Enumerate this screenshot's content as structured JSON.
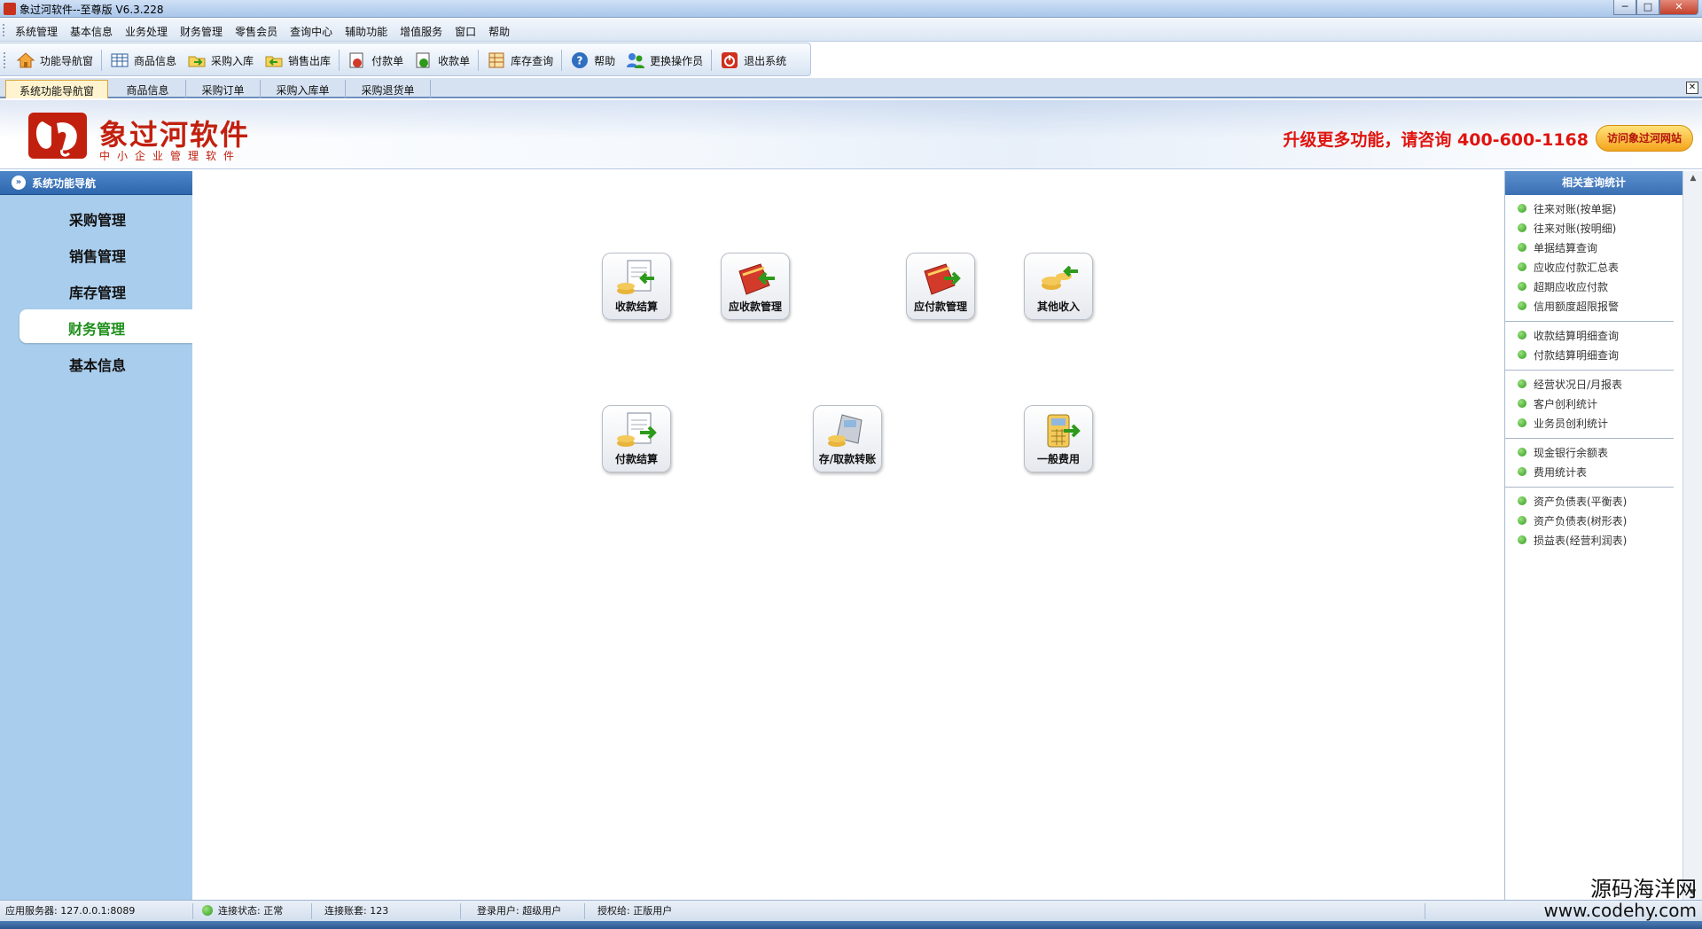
{
  "window": {
    "title": "象过河软件--至尊版 V6.3.228",
    "buttons": {
      "minimize": "─",
      "maximize": "□",
      "close": "✕"
    }
  },
  "menu": [
    "系统管理",
    "基本信息",
    "业务处理",
    "财务管理",
    "零售会员",
    "查询中心",
    "辅助功能",
    "增值服务",
    "窗口",
    "帮助"
  ],
  "toolbar": {
    "nav": "功能导航窗",
    "goods": "商品信息",
    "purchase_in": "采购入库",
    "sales_out": "销售出库",
    "payment": "付款单",
    "receipt": "收款单",
    "stock_query": "库存查询",
    "help": "帮助",
    "switch_user": "更换操作员",
    "exit": "退出系统"
  },
  "tabs": {
    "nav_window": "系统功能导航窗",
    "goods": "商品信息",
    "purchase_order": "采购订单",
    "purchase_in": "采购入库单",
    "purchase_return": "采购退货单",
    "close": "✕"
  },
  "banner": {
    "logo_title": "象过河软件",
    "logo_subtitle": "中小企业管理软件",
    "promo": "升级更多功能，请咨询 400-600-1168",
    "visit_button": "访问象过河网站"
  },
  "leftnav": {
    "header": "系统功能导航",
    "chevron": "»",
    "items": [
      "采购管理",
      "销售管理",
      "库存管理",
      "财务管理",
      "基本信息"
    ],
    "active_index": 3
  },
  "modules": {
    "receipt_settle": "收款结算",
    "receivable": "应收款管理",
    "payable": "应付款管理",
    "other_income": "其他收入",
    "payment_settle": "付款结算",
    "deposit_transfer": "存/取款转账",
    "general_expense": "一般费用"
  },
  "rightpanel": {
    "header": "相关查询统计",
    "groups": [
      [
        "往来对账(按单据)",
        "往来对账(按明细)",
        "单据结算查询",
        "应收应付款汇总表",
        "超期应收应付款",
        "信用额度超限报警"
      ],
      [
        "收款结算明细查询",
        "付款结算明细查询"
      ],
      [
        "经营状况日/月报表",
        "客户创利统计",
        "业务员创利统计"
      ],
      [
        "现金银行余额表",
        "费用统计表"
      ],
      [
        "资产负债表(平衡表)",
        "资产负债表(树形表)",
        "损益表(经营利润表)"
      ]
    ]
  },
  "scroll": {
    "up": "▲",
    "down": "▼"
  },
  "status": {
    "server": "应用服务器: 127.0.0.1:8089",
    "connection": "连接状态: 正常",
    "account_set": "连接账套: 123",
    "user": "登录用户: 超级用户",
    "license": "授权给: 正版用户"
  },
  "watermark": {
    "line1": "源码海洋网",
    "line2": "www.codehy.com"
  },
  "colors": {
    "brand_red": "#c2200f",
    "nav_blue": "#a9cdec",
    "active_green": "#1e8f1a",
    "promo_red": "#e0140f"
  }
}
